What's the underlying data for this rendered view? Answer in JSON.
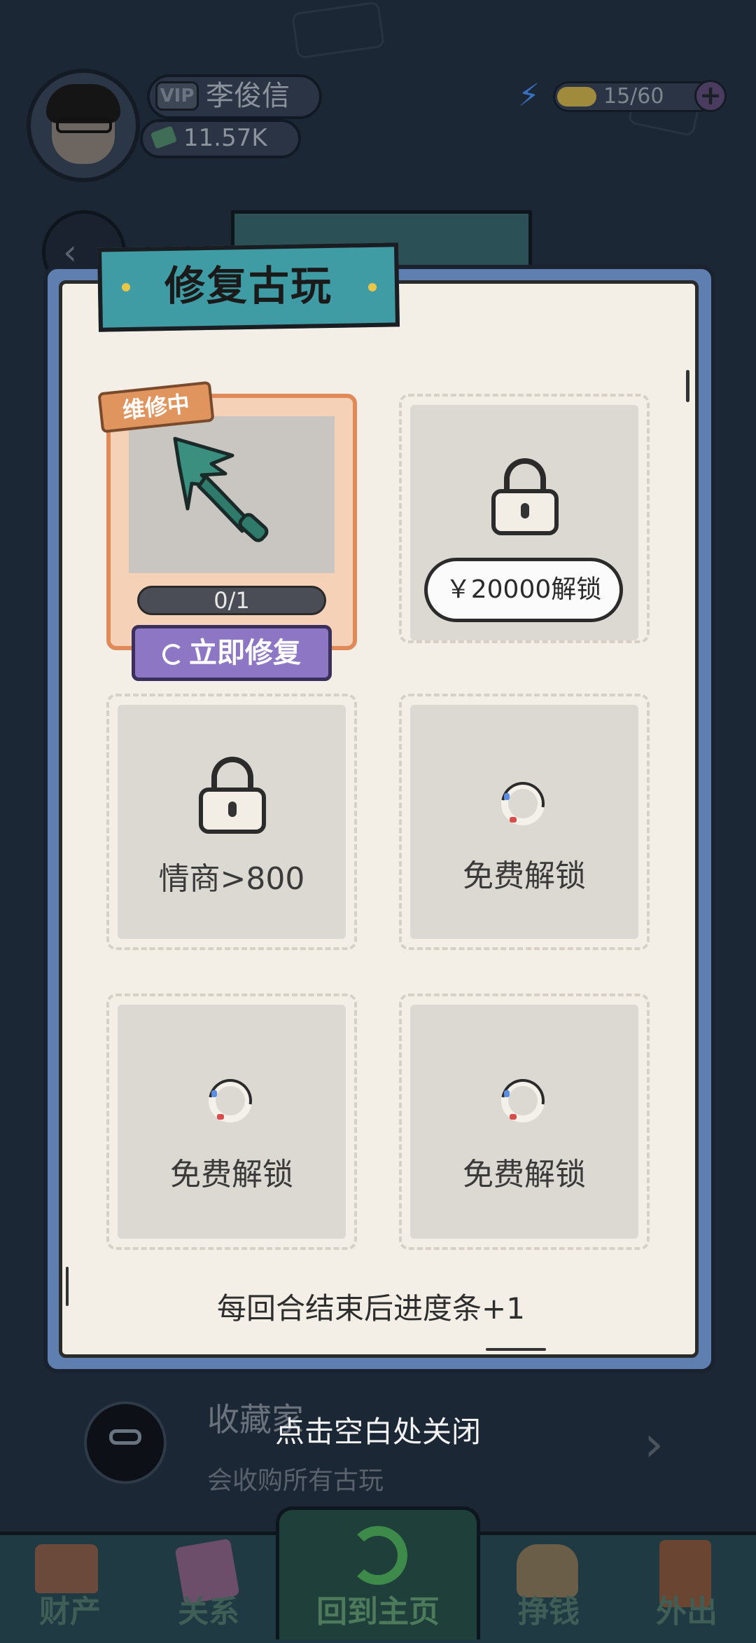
{
  "player": {
    "vip_label": "VIP",
    "name": "李俊信",
    "money": "11.57K",
    "energy": "15/60",
    "energy_plus": "+"
  },
  "dialog": {
    "title": "修复古玩",
    "footer_note": "每回合结束后进度条+1"
  },
  "slots": {
    "active": {
      "tag": "维修中",
      "item_icon": "spear-head-icon",
      "progress_text": "0/1",
      "progress": 0,
      "repair_label": "立即修复"
    },
    "slot2": {
      "unlock_label": "￥20000解锁",
      "icon": "lock-icon"
    },
    "slot3": {
      "label": "情商>800",
      "icon": "lock-icon"
    },
    "slot4": {
      "label": "免费解锁",
      "icon": "ad-spinner-icon"
    },
    "slot5": {
      "label": "免费解锁",
      "icon": "ad-spinner-icon"
    },
    "slot6": {
      "label": "免费解锁",
      "icon": "ad-spinner-icon"
    }
  },
  "background": {
    "collector_name": "收藏家",
    "collector_desc": "会收购所有古玩",
    "close_hint": "点击空白处关闭"
  },
  "nav": {
    "items": [
      {
        "label": "财产",
        "icon": "house-icon"
      },
      {
        "label": "关系",
        "icon": "book-icon"
      },
      {
        "label": "回到主页",
        "icon": "return-arrow-icon"
      },
      {
        "label": "挣钱",
        "icon": "fist-money-icon"
      },
      {
        "label": "外出",
        "icon": "door-icon"
      }
    ]
  },
  "colors": {
    "dialog_frame": "#5f7fb0",
    "title_banner": "#3f9ba4",
    "active_border": "#e08a5a",
    "repair_button": "#8d77c5"
  }
}
